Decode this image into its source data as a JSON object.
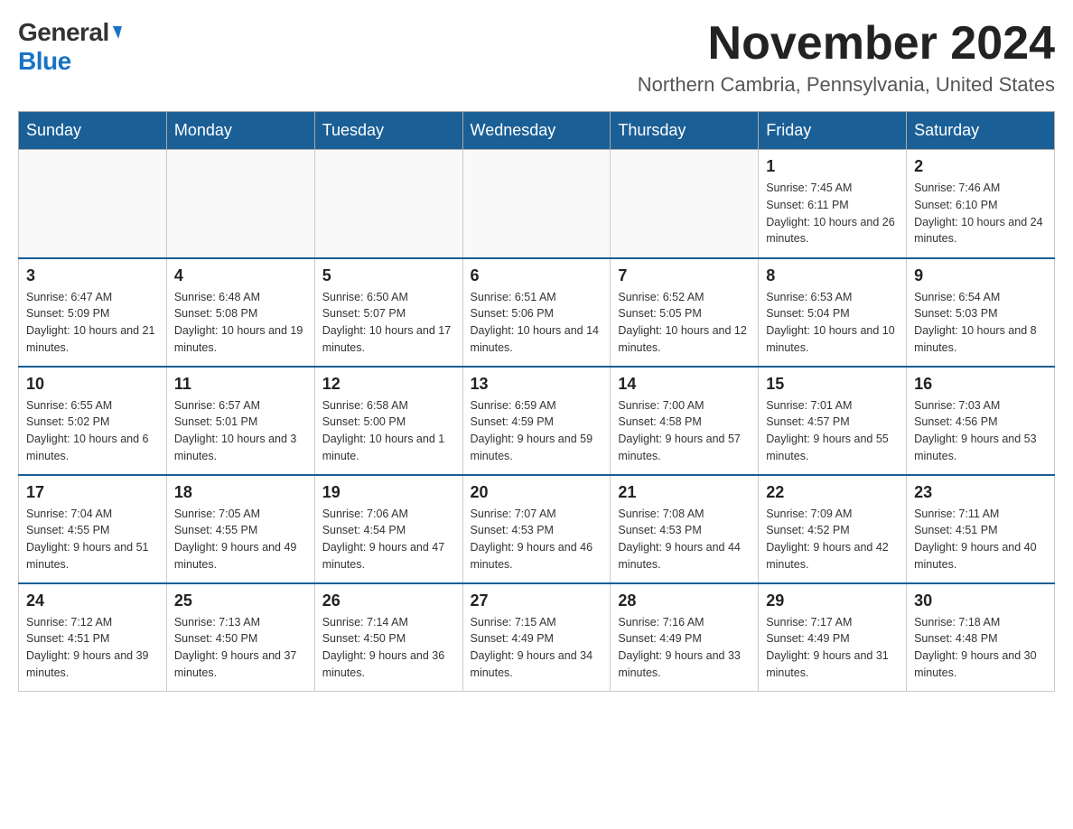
{
  "logo": {
    "general": "General",
    "blue": "Blue"
  },
  "title": "November 2024",
  "location": "Northern Cambria, Pennsylvania, United States",
  "weekdays": [
    "Sunday",
    "Monday",
    "Tuesday",
    "Wednesday",
    "Thursday",
    "Friday",
    "Saturday"
  ],
  "weeks": [
    [
      {
        "day": "",
        "info": ""
      },
      {
        "day": "",
        "info": ""
      },
      {
        "day": "",
        "info": ""
      },
      {
        "day": "",
        "info": ""
      },
      {
        "day": "",
        "info": ""
      },
      {
        "day": "1",
        "info": "Sunrise: 7:45 AM\nSunset: 6:11 PM\nDaylight: 10 hours and 26 minutes."
      },
      {
        "day": "2",
        "info": "Sunrise: 7:46 AM\nSunset: 6:10 PM\nDaylight: 10 hours and 24 minutes."
      }
    ],
    [
      {
        "day": "3",
        "info": "Sunrise: 6:47 AM\nSunset: 5:09 PM\nDaylight: 10 hours and 21 minutes."
      },
      {
        "day": "4",
        "info": "Sunrise: 6:48 AM\nSunset: 5:08 PM\nDaylight: 10 hours and 19 minutes."
      },
      {
        "day": "5",
        "info": "Sunrise: 6:50 AM\nSunset: 5:07 PM\nDaylight: 10 hours and 17 minutes."
      },
      {
        "day": "6",
        "info": "Sunrise: 6:51 AM\nSunset: 5:06 PM\nDaylight: 10 hours and 14 minutes."
      },
      {
        "day": "7",
        "info": "Sunrise: 6:52 AM\nSunset: 5:05 PM\nDaylight: 10 hours and 12 minutes."
      },
      {
        "day": "8",
        "info": "Sunrise: 6:53 AM\nSunset: 5:04 PM\nDaylight: 10 hours and 10 minutes."
      },
      {
        "day": "9",
        "info": "Sunrise: 6:54 AM\nSunset: 5:03 PM\nDaylight: 10 hours and 8 minutes."
      }
    ],
    [
      {
        "day": "10",
        "info": "Sunrise: 6:55 AM\nSunset: 5:02 PM\nDaylight: 10 hours and 6 minutes."
      },
      {
        "day": "11",
        "info": "Sunrise: 6:57 AM\nSunset: 5:01 PM\nDaylight: 10 hours and 3 minutes."
      },
      {
        "day": "12",
        "info": "Sunrise: 6:58 AM\nSunset: 5:00 PM\nDaylight: 10 hours and 1 minute."
      },
      {
        "day": "13",
        "info": "Sunrise: 6:59 AM\nSunset: 4:59 PM\nDaylight: 9 hours and 59 minutes."
      },
      {
        "day": "14",
        "info": "Sunrise: 7:00 AM\nSunset: 4:58 PM\nDaylight: 9 hours and 57 minutes."
      },
      {
        "day": "15",
        "info": "Sunrise: 7:01 AM\nSunset: 4:57 PM\nDaylight: 9 hours and 55 minutes."
      },
      {
        "day": "16",
        "info": "Sunrise: 7:03 AM\nSunset: 4:56 PM\nDaylight: 9 hours and 53 minutes."
      }
    ],
    [
      {
        "day": "17",
        "info": "Sunrise: 7:04 AM\nSunset: 4:55 PM\nDaylight: 9 hours and 51 minutes."
      },
      {
        "day": "18",
        "info": "Sunrise: 7:05 AM\nSunset: 4:55 PM\nDaylight: 9 hours and 49 minutes."
      },
      {
        "day": "19",
        "info": "Sunrise: 7:06 AM\nSunset: 4:54 PM\nDaylight: 9 hours and 47 minutes."
      },
      {
        "day": "20",
        "info": "Sunrise: 7:07 AM\nSunset: 4:53 PM\nDaylight: 9 hours and 46 minutes."
      },
      {
        "day": "21",
        "info": "Sunrise: 7:08 AM\nSunset: 4:53 PM\nDaylight: 9 hours and 44 minutes."
      },
      {
        "day": "22",
        "info": "Sunrise: 7:09 AM\nSunset: 4:52 PM\nDaylight: 9 hours and 42 minutes."
      },
      {
        "day": "23",
        "info": "Sunrise: 7:11 AM\nSunset: 4:51 PM\nDaylight: 9 hours and 40 minutes."
      }
    ],
    [
      {
        "day": "24",
        "info": "Sunrise: 7:12 AM\nSunset: 4:51 PM\nDaylight: 9 hours and 39 minutes."
      },
      {
        "day": "25",
        "info": "Sunrise: 7:13 AM\nSunset: 4:50 PM\nDaylight: 9 hours and 37 minutes."
      },
      {
        "day": "26",
        "info": "Sunrise: 7:14 AM\nSunset: 4:50 PM\nDaylight: 9 hours and 36 minutes."
      },
      {
        "day": "27",
        "info": "Sunrise: 7:15 AM\nSunset: 4:49 PM\nDaylight: 9 hours and 34 minutes."
      },
      {
        "day": "28",
        "info": "Sunrise: 7:16 AM\nSunset: 4:49 PM\nDaylight: 9 hours and 33 minutes."
      },
      {
        "day": "29",
        "info": "Sunrise: 7:17 AM\nSunset: 4:49 PM\nDaylight: 9 hours and 31 minutes."
      },
      {
        "day": "30",
        "info": "Sunrise: 7:18 AM\nSunset: 4:48 PM\nDaylight: 9 hours and 30 minutes."
      }
    ]
  ]
}
